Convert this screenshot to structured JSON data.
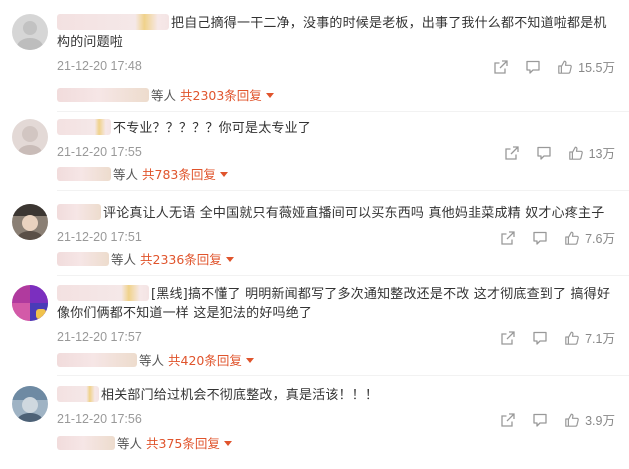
{
  "comments": [
    {
      "text": "把自己摘得一干二净，没事的时候是老板，出事了我什么都不知道啦都是机构的问题啦",
      "time": "21-12-20 17:48",
      "likes": "15.5万",
      "reply_prefix": "等人",
      "reply_link": "共2303条回复"
    },
    {
      "text": "不专业？？？？？你可是太专业了",
      "time": "21-12-20 17:55",
      "likes": "13万",
      "reply_prefix": "等人",
      "reply_link": "共783条回复"
    },
    {
      "text": "评论真让人无语 全中国就只有薇娅直播间可以买东西吗 真他妈韭菜成精 奴才心疼主子",
      "time": "21-12-20 17:51",
      "likes": "7.6万",
      "reply_prefix": "等人",
      "reply_link": "共2336条回复"
    },
    {
      "text": "[黑线]搞不懂了 明明新闻都写了多次通知整改还是不改 这才彻底查到了 搞得好像你们俩都不知道一样 这是犯法的好吗绝了",
      "time": "21-12-20 17:57",
      "likes": "7.1万",
      "reply_prefix": "等人",
      "reply_link": "共420条回复"
    },
    {
      "text": "相关部门给过机会不彻底整改，真是活该！！！",
      "time": "21-12-20 17:56",
      "likes": "3.9万",
      "reply_prefix": "等人",
      "reply_link": "共375条回复"
    }
  ],
  "icons": {
    "share": "share-icon",
    "comment": "comment-icon",
    "like": "thumbs-up-icon",
    "expand": "chevron-down-icon"
  },
  "colors": {
    "link": "#e0542c",
    "meta": "#999999",
    "text": "#333333"
  }
}
